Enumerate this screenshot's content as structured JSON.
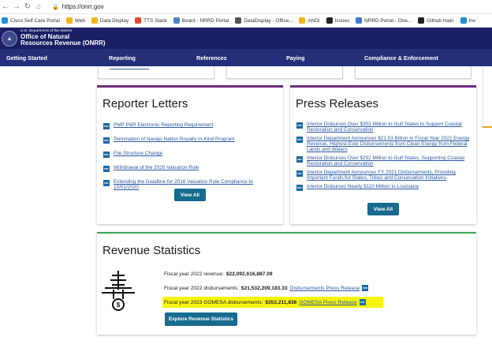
{
  "browser": {
    "url": "https://onrr.gov",
    "bookmarks": [
      {
        "label": "Cisco Self Care Portal",
        "color": "#1f8fd8"
      },
      {
        "label": "Web",
        "color": "#f2b519"
      },
      {
        "label": "Data Display",
        "color": "#f2b519"
      },
      {
        "label": "TTS Slack",
        "color": "#e6492d"
      },
      {
        "label": "Board - NRRD Portal",
        "color": "#4c84c4"
      },
      {
        "label": "DataDisplay - Office...",
        "color": "#555555"
      },
      {
        "label": "ANDI",
        "color": "#f2b519"
      },
      {
        "label": "Issues",
        "color": "#222222"
      },
      {
        "label": "NRRD Portal - One...",
        "color": "#3b7bd1"
      },
      {
        "label": "Github main",
        "color": "#222222"
      },
      {
        "label": "Inv",
        "color": "#1f8fd8"
      }
    ]
  },
  "header": {
    "dept": "U.S. Department of the Interior",
    "office_line1": "Office of Natural",
    "office_line2": "Resources Revenue (ONRR)"
  },
  "nav": {
    "items": [
      "Getting Started",
      "Reporting",
      "References",
      "Paying",
      "Compliance & Enforcement"
    ]
  },
  "reporter_letters": {
    "title": "Reporter Letters",
    "links": [
      "PMP P&R Electronic Reporting Requirement",
      "Termination of Navajo Nation Royalty In-Kind Program",
      "File Structure Change",
      "Withdrawal of the 2020 Valuation Rule",
      "Extending the Deadline for 2016 Valuation Rule Compliance to 10/01/2020"
    ],
    "button": "View All"
  },
  "press_releases": {
    "title": "Press Releases",
    "links": [
      "Interior Disburses Over $353 Million to Gulf States to Support Coastal Restoration and Conservation",
      "Interior Department Announces $21.53 Billion in Fiscal Year 2022 Energy Revenue, Highest-Ever Disbursements from Clean Energy from Federal Lands and Waters",
      "Interior Disburses Over $252 Million to Gulf States, Supporting Coastal Restoration and Conservation",
      "Interior Department Announces FY 2021 Disbursements, Providing Important Funds for States, Tribes and Conservation Initiatives",
      "Interior Disburses Nearly $110 Million to Louisiana"
    ],
    "button": "View All"
  },
  "revenue": {
    "title": "Revenue Statistics",
    "line1_label": "Fiscal year 2022 revenue:",
    "line1_value": "$22,092,616,887.09",
    "line2_label": "Fiscal year 2022 disbursements:",
    "line2_value": "$21,532,209,183.33",
    "line2_link": "Disbursements Press Release",
    "line3_label": "Fiscal year 2023 GOMESA disbursements:",
    "line3_value": "$353,211,836",
    "line3_link": "GOMESA Press Release",
    "button": "Explore Revenue Statistics"
  },
  "pdf_label": "PDF",
  "colors": {
    "header_bg": "#1a1e64",
    "nav_bg": "#242f7a",
    "purple_accent": "#6f2d7e",
    "green_accent": "#3ea85a",
    "button_bg": "#176b8f",
    "link": "#2b59a0",
    "highlight": "#f6f40c"
  }
}
